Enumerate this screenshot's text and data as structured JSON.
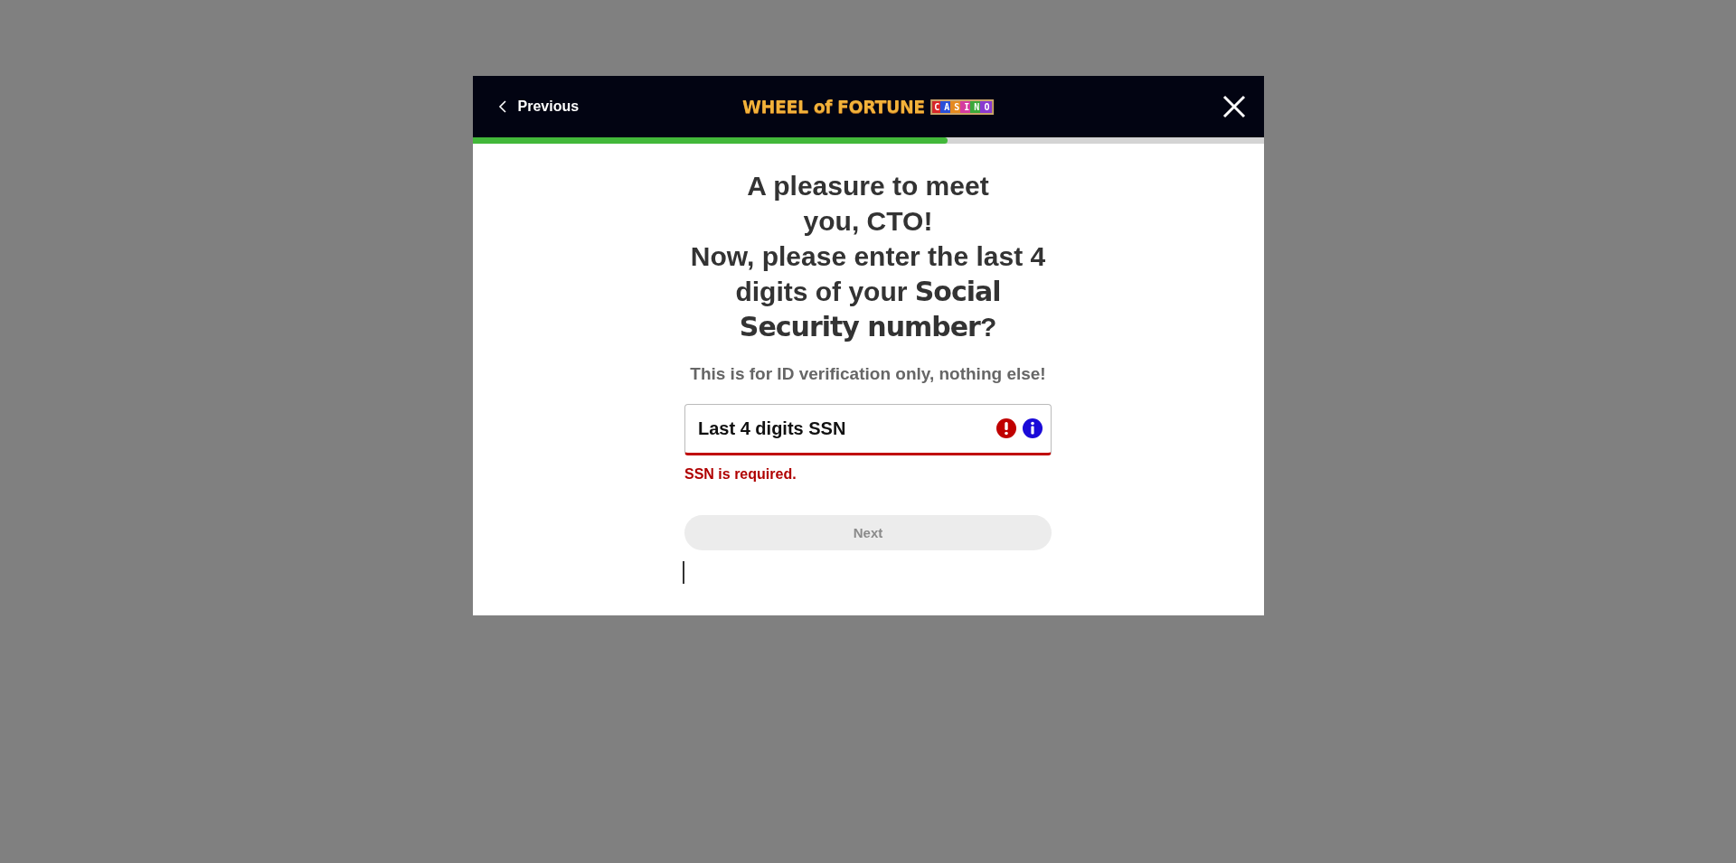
{
  "header": {
    "back_label": "Previous",
    "logo": {
      "title": "WHEEL of FORTUNE",
      "badge": "CASINO"
    }
  },
  "progress": {
    "level": 0.6
  },
  "heading": {
    "greeting": "A pleasure to meet you, CTO!",
    "prompt": "Now, please enter the last 4 digits of your **Social Security number**?"
  },
  "subtitle": "This is for ID verification only, nothing else!",
  "ssn_field": {
    "placeholder": "Last 4 digits SSN",
    "error": true,
    "error_message": "SSN is required."
  },
  "next_button": {
    "label": "Next",
    "disabled": true
  }
}
